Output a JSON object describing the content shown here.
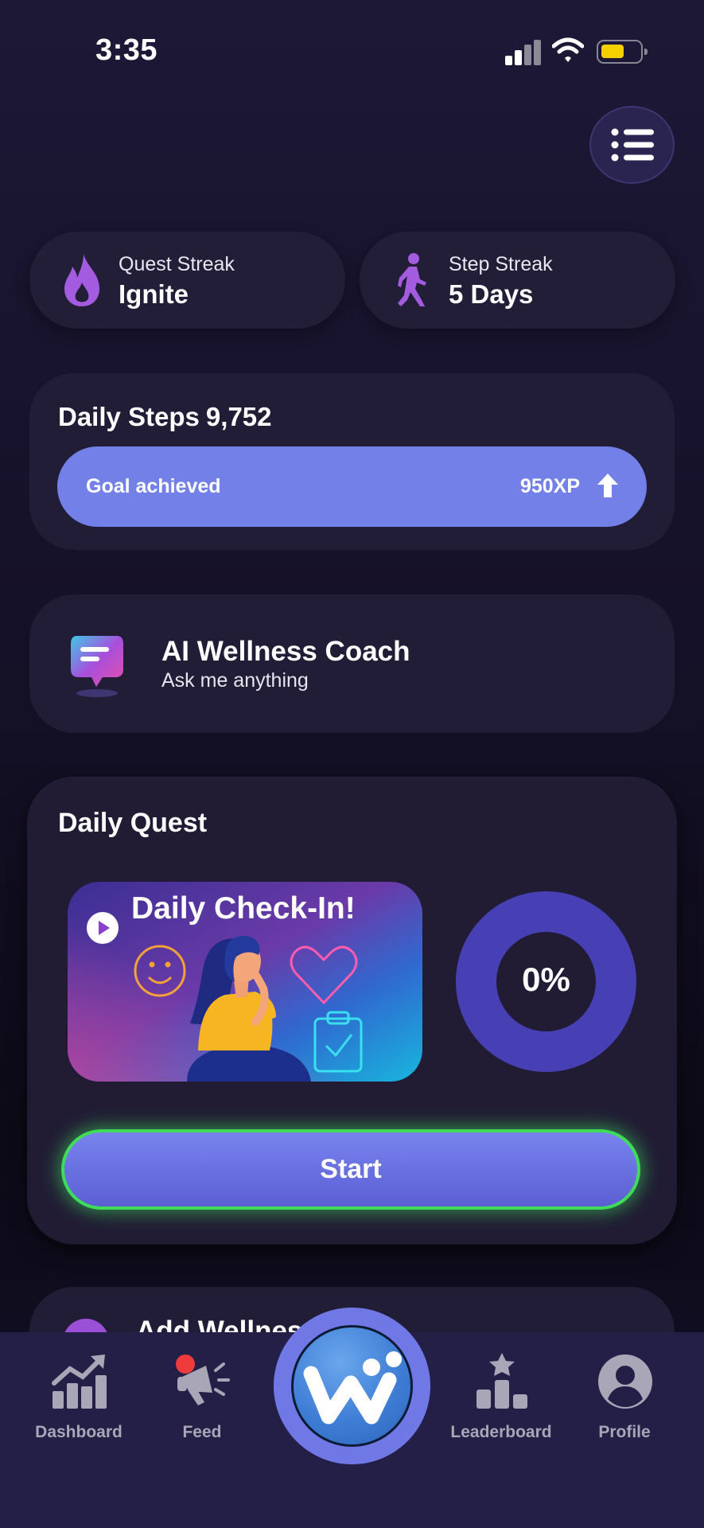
{
  "status_bar": {
    "time": "3:35"
  },
  "streaks": [
    {
      "label": "Quest Streak",
      "value": "Ignite",
      "icon": "flame-icon"
    },
    {
      "label": "Step Streak",
      "value": "5 Days",
      "icon": "walking-icon"
    }
  ],
  "steps": {
    "title": "Daily Steps",
    "count": "9,752",
    "goal_label": "Goal achieved",
    "xp": "950XP"
  },
  "coach": {
    "title": "AI Wellness Coach",
    "subtitle": "Ask me anything"
  },
  "quest": {
    "title": "Daily Quest",
    "image_title": "Daily Check-In!",
    "progress_label": "0%",
    "progress": 0,
    "start_label": "Start"
  },
  "next_card": {
    "title": "Add Wellness"
  },
  "nav": {
    "items": [
      {
        "label": "Dashboard",
        "icon": "chart-growth-icon"
      },
      {
        "label": "Feed",
        "icon": "megaphone-icon"
      },
      {
        "label": "Leaderboard",
        "icon": "podium-icon"
      },
      {
        "label": "Profile",
        "icon": "user-icon"
      }
    ],
    "center_icon": "app-logo-icon"
  },
  "colors": {
    "accent": "#7380e8",
    "card": "#221d36",
    "streak_icon": "#a35be0",
    "start_glow": "#3fdc5a",
    "donut": "#4640b4"
  }
}
